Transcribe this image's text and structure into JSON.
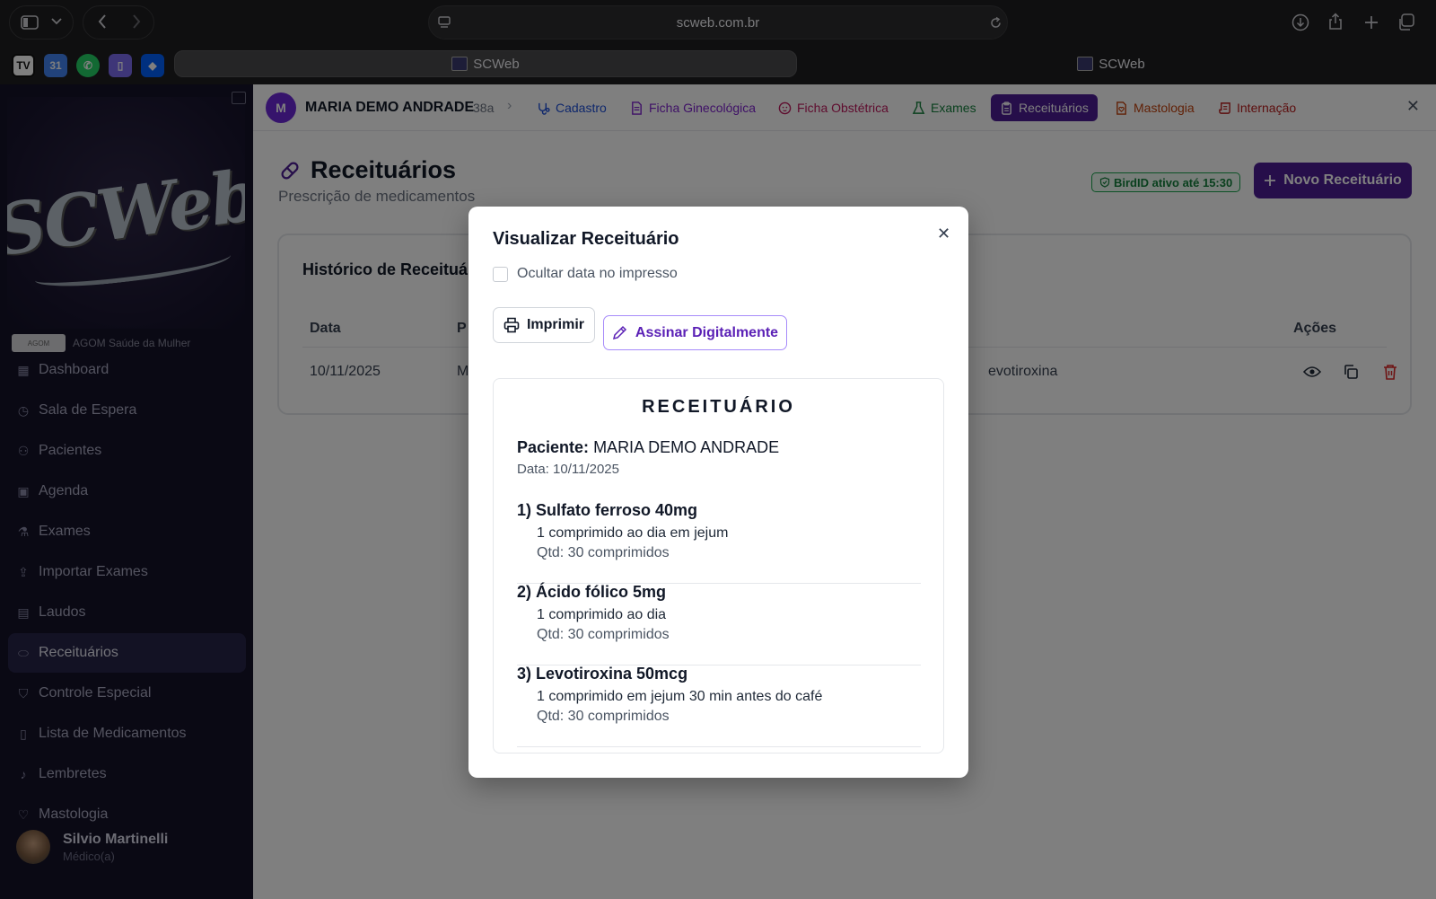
{
  "browser": {
    "url": "scweb.com.br",
    "tabs": [
      {
        "label": "SCWeb",
        "active": true
      },
      {
        "label": "SCWeb",
        "active": false
      }
    ]
  },
  "sidebar": {
    "logo_text": "SCWeb",
    "clinic": "AGOM Saúde da Mulher",
    "items": [
      {
        "label": "Dashboard",
        "icon": "dashboard-icon",
        "glyph": "▦"
      },
      {
        "label": "Sala de Espera",
        "icon": "clock-icon",
        "glyph": "◷"
      },
      {
        "label": "Pacientes",
        "icon": "users-icon",
        "glyph": "⚇"
      },
      {
        "label": "Agenda",
        "icon": "calendar-icon",
        "glyph": "▣"
      },
      {
        "label": "Exames",
        "icon": "flask-icon",
        "glyph": "⚗"
      },
      {
        "label": "Importar Exames",
        "icon": "upload-icon",
        "glyph": "⇪"
      },
      {
        "label": "Laudos",
        "icon": "clipboard-icon",
        "glyph": "▤"
      },
      {
        "label": "Receituários",
        "icon": "pill-icon",
        "glyph": "⬭",
        "active": true
      },
      {
        "label": "Controle Especial",
        "icon": "shield-icon",
        "glyph": "⛉"
      },
      {
        "label": "Lista de Medicamentos",
        "icon": "book-icon",
        "glyph": "▯"
      },
      {
        "label": "Lembretes",
        "icon": "bell-icon",
        "glyph": "♪"
      },
      {
        "label": "Mastologia",
        "icon": "stethoscope-icon",
        "glyph": "♡"
      }
    ],
    "user": {
      "name": "Silvio Martinelli",
      "role": "Médico(a)"
    }
  },
  "patient_bar": {
    "initial": "M",
    "name": "MARIA DEMO ANDRADE",
    "age": "38a",
    "tabs": [
      {
        "label": "Cadastro",
        "color": "#1d4ed8"
      },
      {
        "label": "Ficha Ginecológica",
        "color": "#7e22ce"
      },
      {
        "label": "Ficha Obstétrica",
        "color": "#be185d"
      },
      {
        "label": "Exames",
        "color": "#15803d"
      },
      {
        "label": "Receituários",
        "color": "#ffffff",
        "active": true
      },
      {
        "label": "Mastologia",
        "color": "#c2410c"
      },
      {
        "label": "Internação",
        "color": "#b91c1c"
      }
    ]
  },
  "page": {
    "title": "Receituários",
    "subtitle": "Prescrição de medicamentos",
    "birdid": "BirdID ativo até 15:30",
    "new_button": "Novo Receituário",
    "history_title": "Histórico de Receituários",
    "table": {
      "headers": [
        "Data",
        "P",
        "Ações"
      ],
      "row": {
        "date": "10/11/2025",
        "patient_fragment": "M",
        "meds_fragment": "evotiroxina"
      }
    }
  },
  "modal": {
    "title": "Visualizar Receituário",
    "hide_date_label": "Ocultar data no impresso",
    "hide_date_checked": false,
    "print_button": "Imprimir",
    "sign_button": "Assinar Digitalmente",
    "rx": {
      "title": "RECEITUÁRIO",
      "patient_label": "Paciente:",
      "patient_name": "MARIA DEMO ANDRADE",
      "date": "Data: 10/11/2025",
      "meds": [
        {
          "name": "1) Sulfato ferroso 40mg",
          "posology": "1 comprimido ao dia em jejum",
          "qty": "Qtd: 30 comprimidos"
        },
        {
          "name": "2) Ácido fólico 5mg",
          "posology": "1 comprimido ao dia",
          "qty": "Qtd: 30 comprimidos"
        },
        {
          "name": "3) Levotiroxina 50mcg",
          "posology": "1 comprimido em jejum 30 min antes do café",
          "qty": "Qtd: 30 comprimidos"
        }
      ]
    }
  }
}
